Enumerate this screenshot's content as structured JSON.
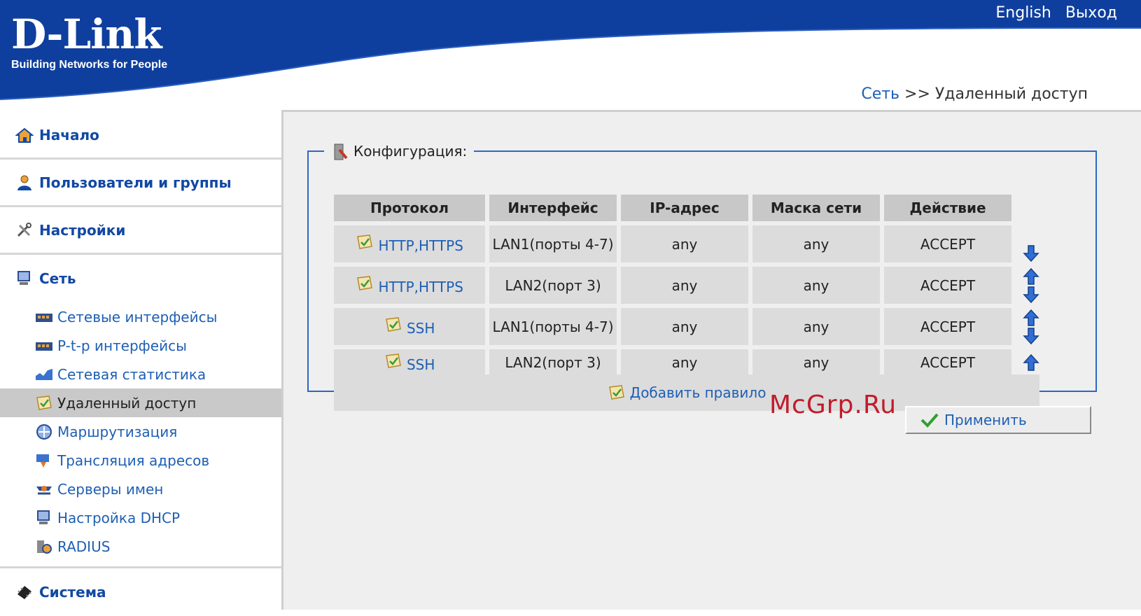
{
  "header": {
    "brand": "D-Link",
    "tagline": "Building Networks for People",
    "links": {
      "english": "English",
      "logout": "Выход"
    },
    "breadcrumb": {
      "parent": "Сеть",
      "separator": ">>",
      "current": "Удаленный доступ"
    }
  },
  "sidebar": {
    "home": "Начало",
    "users": "Пользователи и группы",
    "settings": "Настройки",
    "network": "Сеть",
    "network_items": [
      "Сетевые интерфейсы",
      "P-t-p интерфейсы",
      "Сетевая статистика",
      "Удаленный доступ",
      "Маршрутизация",
      "Трансляция адресов",
      "Серверы имен",
      "Настройка DHCP",
      "RADIUS"
    ],
    "system": "Система"
  },
  "main": {
    "section_title": "Конфигурация:",
    "columns": [
      "Протокол",
      "Интерфейс",
      "IP-адрес",
      "Маска сети",
      "Действие"
    ],
    "rows": [
      {
        "protocol": "HTTP,HTTPS",
        "interface": "LAN1(порты 4-7)",
        "ip": "any",
        "mask": "any",
        "action": "ACCEPT"
      },
      {
        "protocol": "HTTP,HTTPS",
        "interface": "LAN2(порт 3)",
        "ip": "any",
        "mask": "any",
        "action": "ACCEPT"
      },
      {
        "protocol": "SSH",
        "interface": "LAN1(порты 4-7)",
        "ip": "any",
        "mask": "any",
        "action": "ACCEPT"
      },
      {
        "protocol": "SSH",
        "interface": "LAN2(порт 3)",
        "ip": "any",
        "mask": "any",
        "action": "ACCEPT"
      }
    ],
    "add_rule": "Добавить правило",
    "apply": "Применить"
  },
  "watermark": "McGrp.Ru",
  "colors": {
    "brand_blue": "#0f3f9e",
    "link_blue": "#1e5fb4",
    "border_blue": "#2d67c4"
  }
}
